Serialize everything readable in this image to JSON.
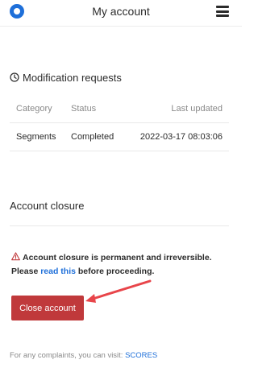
{
  "header": {
    "title": "My account"
  },
  "requests": {
    "title": "Modification requests",
    "columns": [
      "Category",
      "Status",
      "Last updated"
    ],
    "rows": [
      {
        "category": "Segments",
        "status": "Completed",
        "updated": "2022-03-17 08:03:06"
      }
    ]
  },
  "closure": {
    "title": "Account closure",
    "warning_bold": "Account closure is permanent and irreversible.",
    "please": "Please",
    "link": "read this",
    "after_link": "before proceeding.",
    "button": "Close account"
  },
  "footer": {
    "text": "For any complaints, you can visit:",
    "link": "SCORES"
  },
  "colors": {
    "accent": "#1e6fd9",
    "danger": "#c0393b",
    "annotation_arrow": "#e8454a"
  },
  "icons": [
    "logo-icon",
    "hamburger-menu-icon",
    "clock-icon",
    "warning-icon"
  ]
}
